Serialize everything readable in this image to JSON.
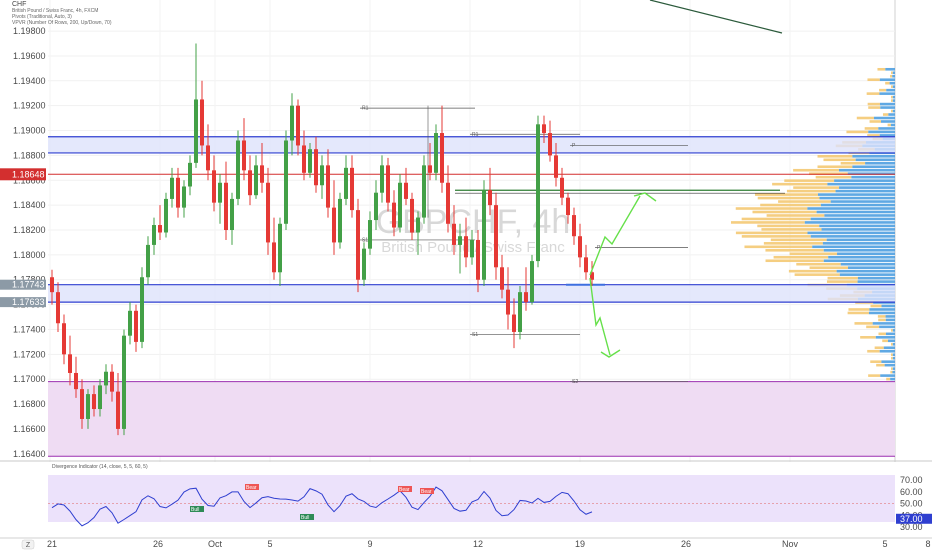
{
  "header": {
    "currency": "CHF",
    "lines": [
      "British Pound / Swiss Franc, 4h, FXCM",
      "Pivots (Traditional, Auto, 3)",
      "VPVR (Number Of Rows, 200, Up/Down, 70)"
    ]
  },
  "watermark": {
    "symbol": "GBPCHF, 4h",
    "name": "British Pound / Swiss Franc"
  },
  "colors": {
    "up": "#43a047",
    "down": "#e53935",
    "support": "#2f3fd0",
    "last_price": "#d32f2f",
    "zone": "#9c2fb0",
    "arrow": "#66e04a",
    "rsi": "#2f3fd0",
    "vp_up": "#f3c66b",
    "vp_down": "#4e9fe0"
  },
  "price_axis": {
    "ticks": [
      "1.19800",
      "1.19600",
      "1.19400",
      "1.19200",
      "1.19000",
      "1.18800",
      "1.18600",
      "1.18400",
      "1.18200",
      "1.18000",
      "1.17800",
      "1.17600",
      "1.17400",
      "1.17200",
      "1.17000",
      "1.16800",
      "1.16600",
      "1.16400"
    ],
    "last_price_label": "1.18648",
    "grey_labels": [
      "1.17743",
      "1.17633"
    ]
  },
  "time_axis": {
    "labels": [
      "21",
      "26",
      "Oct",
      "5",
      "9",
      "12",
      "19",
      "26",
      "Nov",
      "5",
      "8"
    ]
  },
  "chart_data": {
    "type": "candlestick",
    "timeframe": "4h",
    "ylim": [
      1.1635,
      1.2005
    ],
    "candles": [
      [
        1.1782,
        1.1788,
        1.176,
        1.177
      ],
      [
        1.177,
        1.1778,
        1.1738,
        1.1745
      ],
      [
        1.1745,
        1.1752,
        1.1712,
        1.172
      ],
      [
        1.172,
        1.1735,
        1.1695,
        1.1705
      ],
      [
        1.1705,
        1.1718,
        1.1685,
        1.1692
      ],
      [
        1.1692,
        1.17,
        1.166,
        1.1668
      ],
      [
        1.1668,
        1.1692,
        1.166,
        1.1688
      ],
      [
        1.1688,
        1.1695,
        1.167,
        1.1676
      ],
      [
        1.1676,
        1.17,
        1.167,
        1.1695
      ],
      [
        1.1695,
        1.1712,
        1.1688,
        1.1706
      ],
      [
        1.1706,
        1.1712,
        1.1682,
        1.169
      ],
      [
        1.169,
        1.1705,
        1.1655,
        1.166
      ],
      [
        1.166,
        1.174,
        1.1655,
        1.1735
      ],
      [
        1.1735,
        1.1762,
        1.1728,
        1.1755
      ],
      [
        1.1755,
        1.176,
        1.1722,
        1.173
      ],
      [
        1.173,
        1.179,
        1.1725,
        1.1782
      ],
      [
        1.1782,
        1.1815,
        1.1776,
        1.1808
      ],
      [
        1.1808,
        1.183,
        1.18,
        1.1824
      ],
      [
        1.1824,
        1.184,
        1.1812,
        1.1818
      ],
      [
        1.1818,
        1.185,
        1.1814,
        1.1845
      ],
      [
        1.1845,
        1.187,
        1.1838,
        1.1862
      ],
      [
        1.1862,
        1.187,
        1.183,
        1.1838
      ],
      [
        1.1838,
        1.186,
        1.183,
        1.1855
      ],
      [
        1.1855,
        1.188,
        1.1848,
        1.1874
      ],
      [
        1.1874,
        1.197,
        1.187,
        1.1925
      ],
      [
        1.1925,
        1.194,
        1.188,
        1.1888
      ],
      [
        1.1888,
        1.1905,
        1.186,
        1.1868
      ],
      [
        1.1868,
        1.188,
        1.1835,
        1.1842
      ],
      [
        1.1842,
        1.1865,
        1.1825,
        1.1858
      ],
      [
        1.1858,
        1.1875,
        1.1812,
        1.182
      ],
      [
        1.182,
        1.185,
        1.1808,
        1.1845
      ],
      [
        1.1845,
        1.19,
        1.184,
        1.1892
      ],
      [
        1.1892,
        1.191,
        1.186,
        1.1868
      ],
      [
        1.1868,
        1.188,
        1.184,
        1.1848
      ],
      [
        1.1848,
        1.188,
        1.1845,
        1.1872
      ],
      [
        1.1872,
        1.189,
        1.185,
        1.1858
      ],
      [
        1.1858,
        1.187,
        1.18,
        1.181
      ],
      [
        1.181,
        1.183,
        1.178,
        1.1786
      ],
      [
        1.1786,
        1.183,
        1.1775,
        1.1825
      ],
      [
        1.1825,
        1.19,
        1.182,
        1.1892
      ],
      [
        1.1892,
        1.193,
        1.188,
        1.192
      ],
      [
        1.192,
        1.1925,
        1.188,
        1.1888
      ],
      [
        1.1888,
        1.19,
        1.186,
        1.1866
      ],
      [
        1.1866,
        1.189,
        1.1862,
        1.1885
      ],
      [
        1.1885,
        1.1895,
        1.185,
        1.1856
      ],
      [
        1.1856,
        1.188,
        1.1845,
        1.1872
      ],
      [
        1.1872,
        1.1885,
        1.183,
        1.1838
      ],
      [
        1.1838,
        1.186,
        1.18,
        1.181
      ],
      [
        1.181,
        1.185,
        1.1805,
        1.1845
      ],
      [
        1.1845,
        1.188,
        1.184,
        1.187
      ],
      [
        1.187,
        1.188,
        1.183,
        1.1836
      ],
      [
        1.1836,
        1.1845,
        1.177,
        1.178
      ],
      [
        1.178,
        1.181,
        1.1775,
        1.1805
      ],
      [
        1.1805,
        1.1835,
        1.18,
        1.1828
      ],
      [
        1.1828,
        1.186,
        1.182,
        1.185
      ],
      [
        1.185,
        1.188,
        1.1842,
        1.1872
      ],
      [
        1.1872,
        1.1878,
        1.1835,
        1.1842
      ],
      [
        1.1842,
        1.1852,
        1.1815,
        1.1822
      ],
      [
        1.1822,
        1.1865,
        1.1818,
        1.1858
      ],
      [
        1.1858,
        1.187,
        1.184,
        1.1845
      ],
      [
        1.1845,
        1.185,
        1.1812,
        1.1818
      ],
      [
        1.1818,
        1.1835,
        1.18,
        1.183
      ],
      [
        1.183,
        1.188,
        1.1825,
        1.1872
      ],
      [
        1.1872,
        1.189,
        1.186,
        1.1866
      ],
      [
        1.1866,
        1.1905,
        1.186,
        1.1898
      ],
      [
        1.1898,
        1.192,
        1.185,
        1.1858
      ],
      [
        1.1858,
        1.1872,
        1.1818,
        1.1825
      ],
      [
        1.1825,
        1.184,
        1.18,
        1.1808
      ],
      [
        1.1808,
        1.1825,
        1.1785,
        1.1815
      ],
      [
        1.1815,
        1.183,
        1.179,
        1.1798
      ],
      [
        1.1798,
        1.182,
        1.1792,
        1.1812
      ],
      [
        1.1812,
        1.182,
        1.177,
        1.178
      ],
      [
        1.178,
        1.186,
        1.1775,
        1.1852
      ],
      [
        1.1852,
        1.187,
        1.1832,
        1.184
      ],
      [
        1.184,
        1.185,
        1.178,
        1.179
      ],
      [
        1.179,
        1.18,
        1.1765,
        1.1772
      ],
      [
        1.1772,
        1.179,
        1.174,
        1.1752
      ],
      [
        1.1752,
        1.1765,
        1.1725,
        1.1738
      ],
      [
        1.1738,
        1.1775,
        1.1732,
        1.177
      ],
      [
        1.177,
        1.179,
        1.1755,
        1.1762
      ],
      [
        1.1762,
        1.18,
        1.176,
        1.1795
      ],
      [
        1.1795,
        1.1912,
        1.179,
        1.1905
      ],
      [
        1.1905,
        1.1912,
        1.189,
        1.1898
      ],
      [
        1.1898,
        1.1908,
        1.1875,
        1.188
      ],
      [
        1.188,
        1.189,
        1.1855,
        1.1862
      ],
      [
        1.1862,
        1.187,
        1.184,
        1.1846
      ],
      [
        1.1846,
        1.185,
        1.1825,
        1.1832
      ],
      [
        1.1832,
        1.1838,
        1.1808,
        1.1815
      ],
      [
        1.1815,
        1.1825,
        1.179,
        1.1798
      ],
      [
        1.1798,
        1.1808,
        1.178,
        1.1786
      ],
      [
        1.1786,
        1.1795,
        1.1775,
        1.178
      ]
    ],
    "levels": {
      "horizontal_support": [
        1.1895,
        1.1882,
        1.1776,
        1.1762
      ],
      "last_price": 1.18648,
      "zone": [
        1.1698,
        1.1638
      ],
      "green_line": 1.1852
    },
    "pivot_labels": [
      "R1",
      "P",
      "S1",
      "R1",
      "P",
      "S1",
      "S2"
    ],
    "rsi": {
      "ticks": [
        "70.00",
        "60.00",
        "50.00",
        "40.00",
        "30.00"
      ],
      "labels": [
        "Bear",
        "Bull",
        "Bull",
        "Bear",
        "Bear"
      ],
      "value_label": "37.00",
      "indicator_title": "Divergence Indicator (14, close, 5, 5, 60, 5)"
    }
  }
}
